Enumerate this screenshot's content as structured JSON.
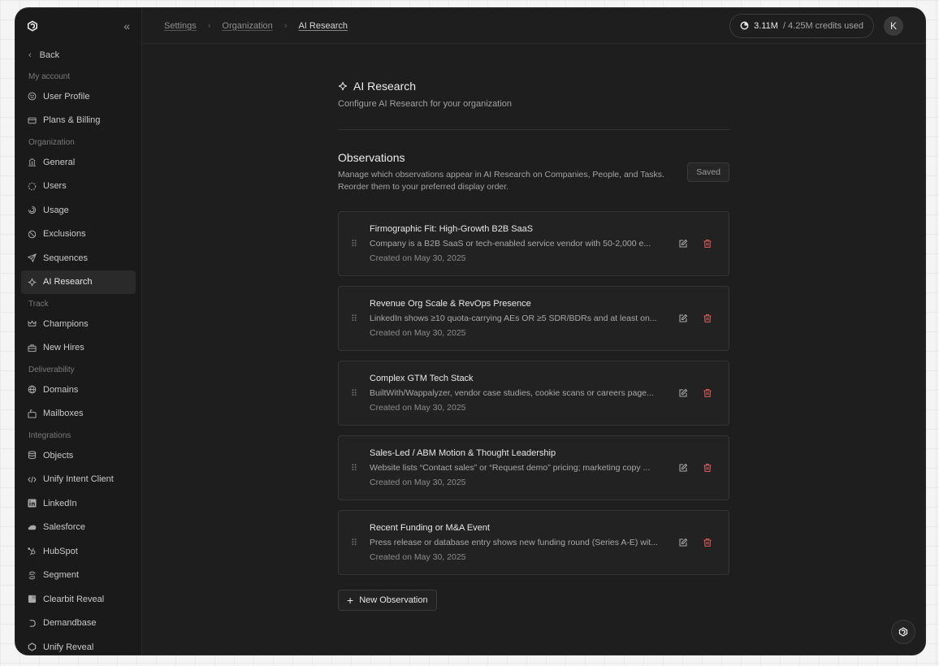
{
  "sidebar": {
    "back_label": "Back",
    "sections": [
      {
        "label": "My account",
        "items": [
          {
            "label": "User Profile",
            "icon": "smile-icon",
            "active": false
          },
          {
            "label": "Plans & Billing",
            "icon": "card-icon",
            "active": false
          }
        ]
      },
      {
        "label": "Organization",
        "items": [
          {
            "label": "General",
            "icon": "building-icon",
            "active": false
          },
          {
            "label": "Users",
            "icon": "users-icon",
            "active": false
          },
          {
            "label": "Usage",
            "icon": "usage-icon",
            "active": false
          },
          {
            "label": "Exclusions",
            "icon": "ban-icon",
            "active": false
          },
          {
            "label": "Sequences",
            "icon": "send-icon",
            "active": false
          },
          {
            "label": "AI Research",
            "icon": "sparkle-icon",
            "active": true
          }
        ]
      },
      {
        "label": "Track",
        "items": [
          {
            "label": "Champions",
            "icon": "crown-icon",
            "active": false
          },
          {
            "label": "New Hires",
            "icon": "briefcase-icon",
            "active": false
          }
        ]
      },
      {
        "label": "Deliverability",
        "items": [
          {
            "label": "Domains",
            "icon": "globe-icon",
            "active": false
          },
          {
            "label": "Mailboxes",
            "icon": "mailbox-icon",
            "active": false
          }
        ]
      },
      {
        "label": "Integrations",
        "items": [
          {
            "label": "Objects",
            "icon": "database-icon",
            "active": false
          },
          {
            "label": "Unify Intent Client",
            "icon": "code-icon",
            "active": false
          },
          {
            "label": "LinkedIn",
            "icon": "linkedin-icon",
            "active": false
          },
          {
            "label": "Salesforce",
            "icon": "salesforce-icon",
            "active": false
          },
          {
            "label": "HubSpot",
            "icon": "hubspot-icon",
            "active": false
          },
          {
            "label": "Segment",
            "icon": "segment-icon",
            "active": false
          },
          {
            "label": "Clearbit Reveal",
            "icon": "clearbit-icon",
            "active": false
          },
          {
            "label": "Demandbase",
            "icon": "demandbase-icon",
            "active": false
          },
          {
            "label": "Unify Reveal",
            "icon": "reveal-icon",
            "active": false
          }
        ]
      }
    ]
  },
  "breadcrumb": [
    "Settings",
    "Organization",
    "AI Research"
  ],
  "credits": {
    "used": "3.11M",
    "rest": "/ 4.25M credits used"
  },
  "avatar_initial": "K",
  "page": {
    "title": "AI Research",
    "subtitle": "Configure AI Research for your organization"
  },
  "observations": {
    "title": "Observations",
    "description": "Manage which observations appear in AI Research on Companies, People, and Tasks. Reorder them to your preferred display order.",
    "saved_label": "Saved",
    "new_label": "New Observation",
    "items": [
      {
        "title": "Firmographic Fit: High-Growth B2B SaaS",
        "text": "Company is a B2B SaaS or tech-enabled service vendor with 50-2,000 e...",
        "date": "Created on May 30, 2025"
      },
      {
        "title": "Revenue Org Scale & RevOps Presence",
        "text": "LinkedIn shows ≥10 quota-carrying AEs OR ≥5 SDR/BDRs and at least on...",
        "date": "Created on May 30, 2025"
      },
      {
        "title": "Complex GTM Tech Stack",
        "text": "BuiltWith/Wappalyzer, vendor case studies, cookie scans or careers page...",
        "date": "Created on May 30, 2025"
      },
      {
        "title": "Sales-Led / ABM Motion & Thought Leadership",
        "text": "Website lists “Contact sales” or “Request demo” pricing; marketing copy ...",
        "date": "Created on May 30, 2025"
      },
      {
        "title": "Recent Funding or M&A Event",
        "text": "Press release or database entry shows new funding round (Series A-E) wit...",
        "date": "Created on May 30, 2025"
      }
    ]
  }
}
